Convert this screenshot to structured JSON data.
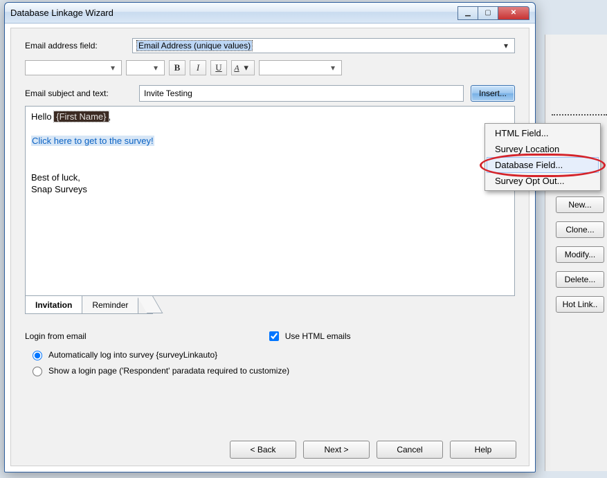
{
  "window": {
    "title": "Database Linkage Wizard"
  },
  "emailField": {
    "label": "Email address field:",
    "value": "Email Address (unique values)"
  },
  "subject": {
    "label": "Email subject and text:",
    "value": "Invite Testing",
    "insert": "Insert..."
  },
  "body": {
    "greet_pre": "Hello ",
    "merge": "{First Name}",
    "greet_post": ",",
    "link": "Click here to get to the survey!",
    "signoff1": "Best of luck,",
    "signoff2": "Snap Surveys"
  },
  "tabs": {
    "invitation": "Invitation",
    "reminder": "Reminder"
  },
  "login": {
    "heading": "Login from email",
    "useHtml": "Use HTML emails",
    "auto": "Automatically log into survey {surveyLinkauto}",
    "loginPage": "Show a login page ('Respondent' paradata required to customize)"
  },
  "footer": {
    "back": "< Back",
    "next": "Next >",
    "cancel": "Cancel",
    "help": "Help"
  },
  "menu": {
    "m1": "HTML Field...",
    "m2": "Survey Location",
    "m3": "Database Field...",
    "m4": "Survey Opt Out..."
  },
  "sideButtons": {
    "b1": "New...",
    "b2": "Clone...",
    "b3": "Modify...",
    "b4": "Delete...",
    "b5": "Hot Link.."
  }
}
